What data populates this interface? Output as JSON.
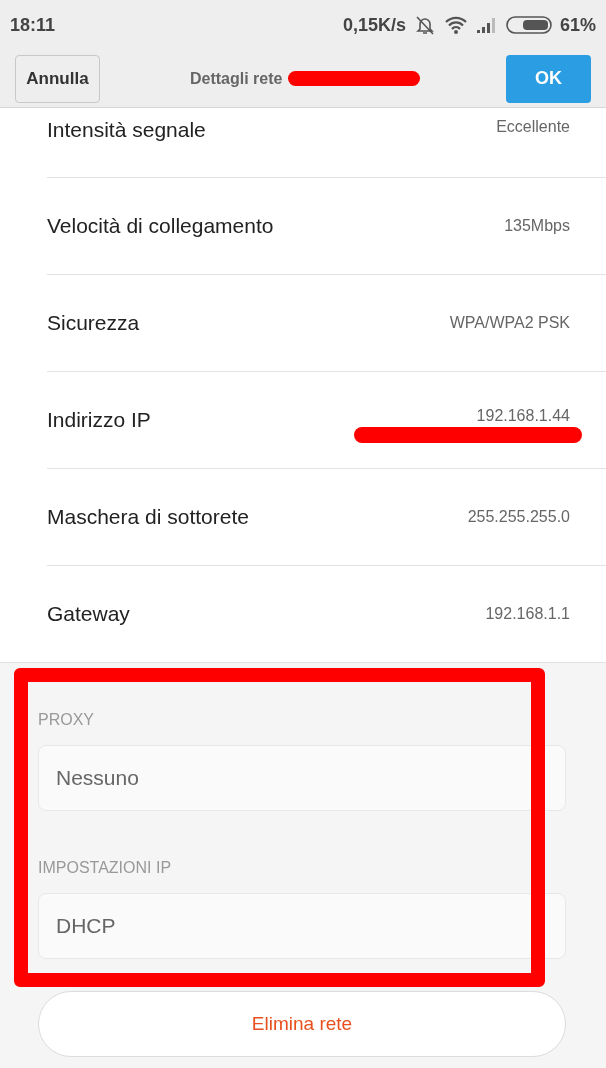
{
  "status_bar": {
    "time": "18:11",
    "speed": "0,15K/s",
    "battery": "61%"
  },
  "header": {
    "cancel": "Annulla",
    "title": "Dettagli rete",
    "ok": "OK"
  },
  "rows": [
    {
      "label": "Intensità segnale",
      "value": "Eccellente"
    },
    {
      "label": "Velocità di collegamento",
      "value": "135Mbps"
    },
    {
      "label": "Sicurezza",
      "value": "WPA/WPA2 PSK"
    },
    {
      "label": "Indirizzo IP",
      "value": "192.168.1.44"
    },
    {
      "label": "Maschera di sottorete",
      "value": "255.255.255.0"
    },
    {
      "label": "Gateway",
      "value": "192.168.1.1"
    }
  ],
  "settings": [
    {
      "label": "PROXY",
      "value": "Nessuno"
    },
    {
      "label": "IMPOSTAZIONI IP",
      "value": "DHCP"
    }
  ],
  "delete_button": "Elimina rete"
}
